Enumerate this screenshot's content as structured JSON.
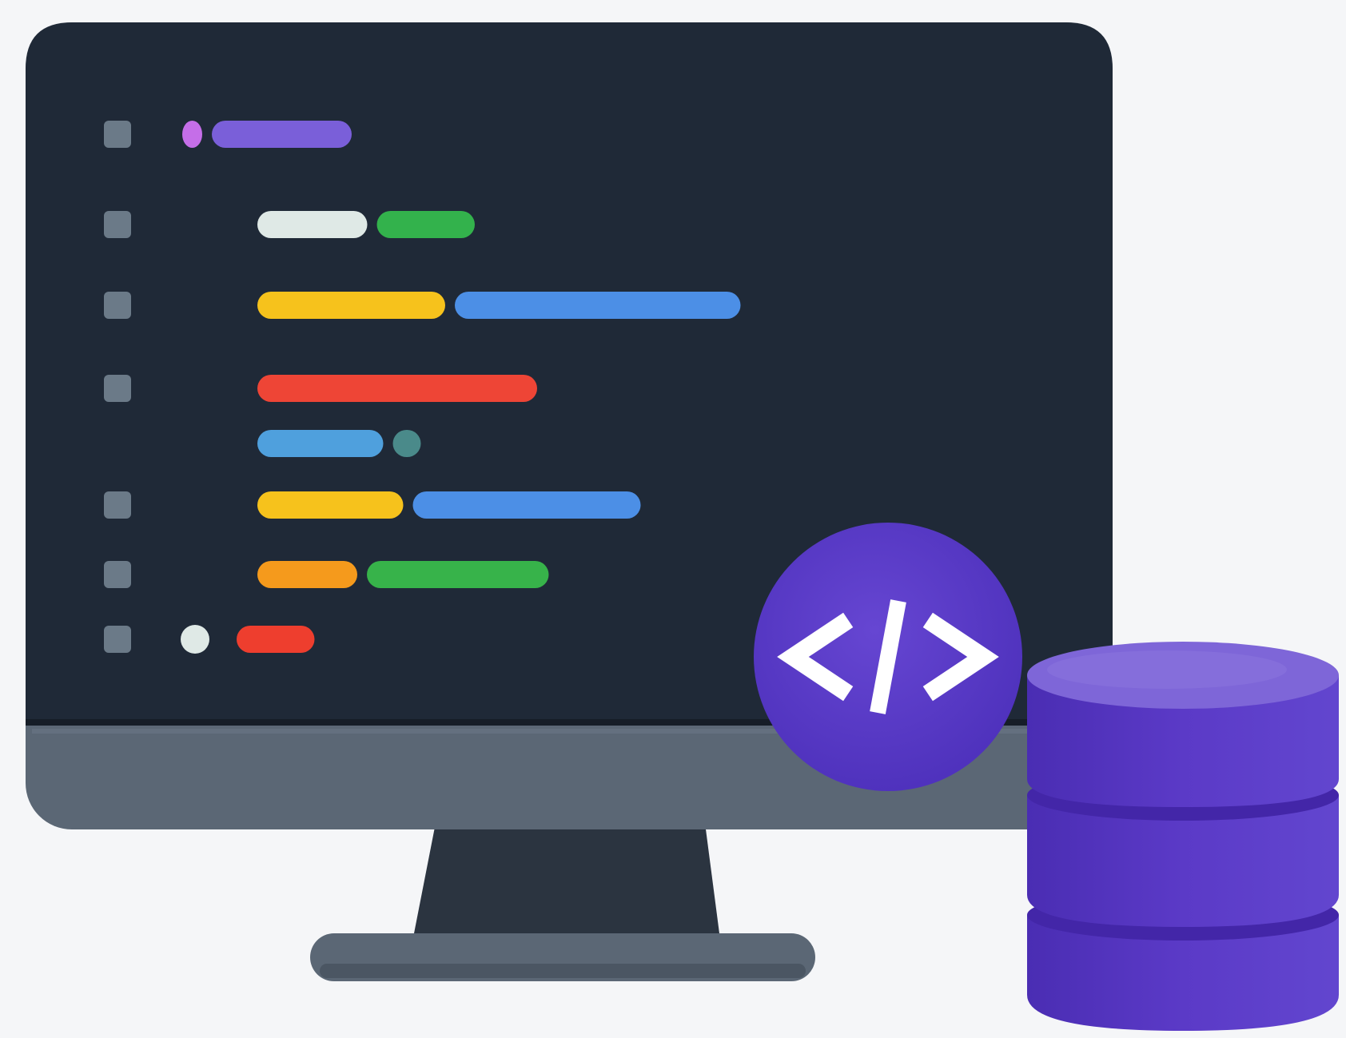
{
  "illustration": {
    "colors": {
      "background": "#f5f6f8",
      "screen": "#1f2937",
      "monitor_chin": "#5b6775",
      "stand": "#2b3440",
      "stand_base": "#5b6775",
      "gutter_marker": "#6b7a88",
      "code_badge": "#5a3cc4",
      "database": "#5b3ac7",
      "database_top": "#7e66d8"
    },
    "icons": [
      "monitor-icon",
      "code-brackets-icon",
      "database-icon"
    ],
    "code_lines": [
      {
        "marker": true,
        "indent": 0,
        "bars": [
          {
            "color": "#c56ee8",
            "weight": 1.0
          },
          {
            "color": "#7a5fd9",
            "weight": 7.0
          }
        ]
      },
      {
        "marker": true,
        "indent": 1,
        "bars": [
          {
            "color": "#dfe9e6",
            "weight": 5.5
          },
          {
            "color": "#33b24c",
            "weight": 4.9
          }
        ]
      },
      {
        "marker": true,
        "indent": 1,
        "bars": [
          {
            "color": "#f6c21c",
            "weight": 9.4
          },
          {
            "color": "#4c8fe6",
            "weight": 14.3
          }
        ]
      },
      {
        "marker": true,
        "indent": 1,
        "bars": [
          {
            "color": "#ee4536",
            "weight": 14.0
          }
        ]
      },
      {
        "marker": false,
        "indent": 1,
        "bars": [
          {
            "color": "#4fa0dd",
            "weight": 6.3
          },
          {
            "color": "#4a8a8a",
            "weight": 1.4
          }
        ]
      },
      {
        "marker": true,
        "indent": 1,
        "bars": [
          {
            "color": "#f6c21c",
            "weight": 7.3
          },
          {
            "color": "#4c8fe6",
            "weight": 11.4
          }
        ]
      },
      {
        "marker": true,
        "indent": 1,
        "bars": [
          {
            "color": "#f59a1c",
            "weight": 5.0
          },
          {
            "color": "#37b34a",
            "weight": 9.1
          }
        ]
      },
      {
        "marker": true,
        "indent": 0,
        "dot": "#dfe9e6",
        "bars": [
          {
            "color": "#ee3e2e",
            "weight": 3.9
          }
        ]
      }
    ]
  }
}
